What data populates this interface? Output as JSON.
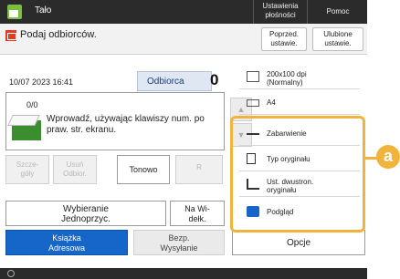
{
  "topbar": {
    "app": "Tało",
    "settings": "Ustawienia\npłośności",
    "help": "Pomoc"
  },
  "header": {
    "prompt": "Podaj odbiorców.",
    "prev_settings": "Poprzed.\nustawie.",
    "fav_settings": "Ulubione\nustawie."
  },
  "info": {
    "datetime": "10/07 2023 16:41",
    "recipient_label": "Odbiorca",
    "recipient_count": "0"
  },
  "input": {
    "count": "0/0",
    "hint": "Wprowadź, używając klawiszy num. po praw. str. ekranu."
  },
  "small_buttons": {
    "details": "Szcze-\ngóły",
    "delete": "Usuń\nOdbior.",
    "tone": "Tonowo",
    "r": "R"
  },
  "buttons": {
    "one_touch": "Wybieranie\nJednoprzyc.",
    "on_hook": "Na Wi-\ndełk.",
    "address_book": "Książka\nAdresowa",
    "direct_send": "Bezp.\nWysyłanie",
    "options": "Opcje"
  },
  "right_panel": {
    "resolution": "200x100 dpi\n(Normalny)",
    "paper": "A4",
    "darkness": "Zabarwienie",
    "original_type": "Typ oryginału",
    "duplex": "Ust. dwustron.\noryginału",
    "preview": "Podgląd"
  },
  "callout": "a",
  "colors": {
    "accent": "#f2b33d",
    "blue": "#1665c8",
    "topbar": "#2b2b2b"
  }
}
